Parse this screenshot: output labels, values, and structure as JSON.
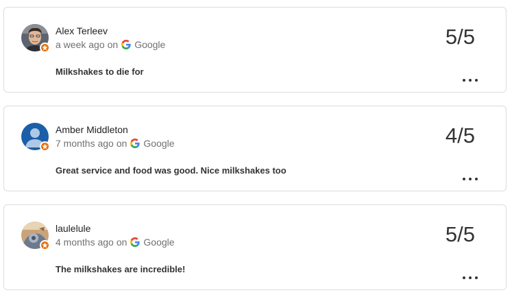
{
  "reviews": [
    {
      "author": "Alex Terleev",
      "time": "a week ago",
      "on": "on",
      "source": "Google",
      "text": "Milkshakes to die for",
      "score": "5/5",
      "avatar_icon": "person-photo-icon",
      "badge_icon": "local-guide-badge-icon"
    },
    {
      "author": "Amber Middleton",
      "time": "7 months ago",
      "on": "on",
      "source": "Google",
      "text": "Great service and food was good. Nice milkshakes too",
      "score": "4/5",
      "avatar_icon": "default-user-icon",
      "badge_icon": "local-guide-badge-icon"
    },
    {
      "author": "laulelule",
      "time": "4 months ago",
      "on": "on",
      "source": "Google",
      "text": "The milkshakes are incredible!",
      "score": "5/5",
      "avatar_icon": "photo-avatar-icon",
      "badge_icon": "local-guide-badge-icon"
    }
  ],
  "colors": {
    "badge": "#e8710a",
    "google_blue": "#4285F4",
    "google_red": "#EA4335",
    "google_yellow": "#FBBC05",
    "google_green": "#34A853",
    "default_avatar": "#1a5fa8"
  }
}
